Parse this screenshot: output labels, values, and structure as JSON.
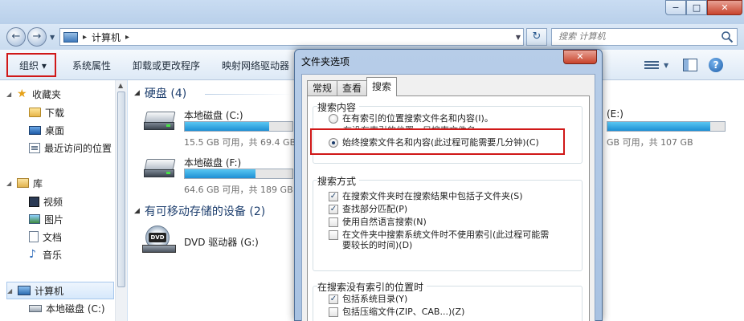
{
  "window": {
    "minimize_glyph": "−",
    "maximize_glyph": "□",
    "close_glyph": "✕"
  },
  "address": {
    "back_glyph": "←",
    "forward_glyph": "→",
    "path_separator": "▸",
    "path": "计算机",
    "search_placeholder": "搜索 计算机",
    "refresh_glyph": "↻"
  },
  "toolbar": {
    "organize": "组织 ▾",
    "system_properties": "系统属性",
    "uninstall": "卸载或更改程序",
    "map_drive": "映射网络驱动器",
    "help_glyph": "?"
  },
  "nav": {
    "favorites": "收藏夹",
    "downloads": "下载",
    "desktop": "桌面",
    "recent": "最近访问的位置",
    "libraries": "库",
    "videos": "视频",
    "pictures": "图片",
    "documents": "文档",
    "music": "音乐",
    "computer": "计算机",
    "local_c": "本地磁盘 (C:)"
  },
  "content": {
    "hdd_group": "硬盘 (4)",
    "removable_group": "有可移动存储的设备 (2)",
    "drives": [
      {
        "name": "本地磁盘 (C:)",
        "free": "15.5 GB 可用，共 69.4 GB",
        "used_fraction": 0.78
      },
      {
        "name": "本地磁盘 (F:)",
        "free": "64.6 GB 可用，共 189 GB",
        "used_fraction": 0.66
      },
      {
        "name": "DVD 驱动器 (G:)"
      },
      {
        "name": "(E:)",
        "free": "GB 可用，共 107 GB",
        "used_fraction": 0.88
      }
    ]
  },
  "dialog": {
    "title": "文件夹选项",
    "close_glyph": "✕",
    "tabs": [
      "常规",
      "查看",
      "搜索"
    ],
    "group_search_content": "搜索内容",
    "radio_index": "在有索引的位置搜索文件名和内容(I)。",
    "radio_index_note": "在没有索引的位置，只搜索文件名。",
    "radio_always": "始终搜索文件名和内容(此过程可能需要几分钟)(C)",
    "group_search_mode": "搜索方式",
    "chk_subfolders": "在搜索文件夹时在搜索结果中包括子文件夹(S)",
    "chk_partial": "查找部分匹配(P)",
    "chk_natural": "使用自然语言搜索(N)",
    "chk_noindex_1": "在文件夹中搜索系统文件时不使用索引(此过程可能需",
    "chk_noindex_2": "要较长的时间)(D)",
    "group_nonindexed": "在搜索没有索引的位置时",
    "chk_sysdirs": "包括系统目录(Y)",
    "chk_compressed": "包括压缩文件(ZIP、CAB...)(Z)",
    "check_glyph": "✓"
  },
  "colors": {
    "highlight_red": "#d01818",
    "capacity_bar": "#1e8fd4",
    "group_header": "#1e3f6e"
  }
}
